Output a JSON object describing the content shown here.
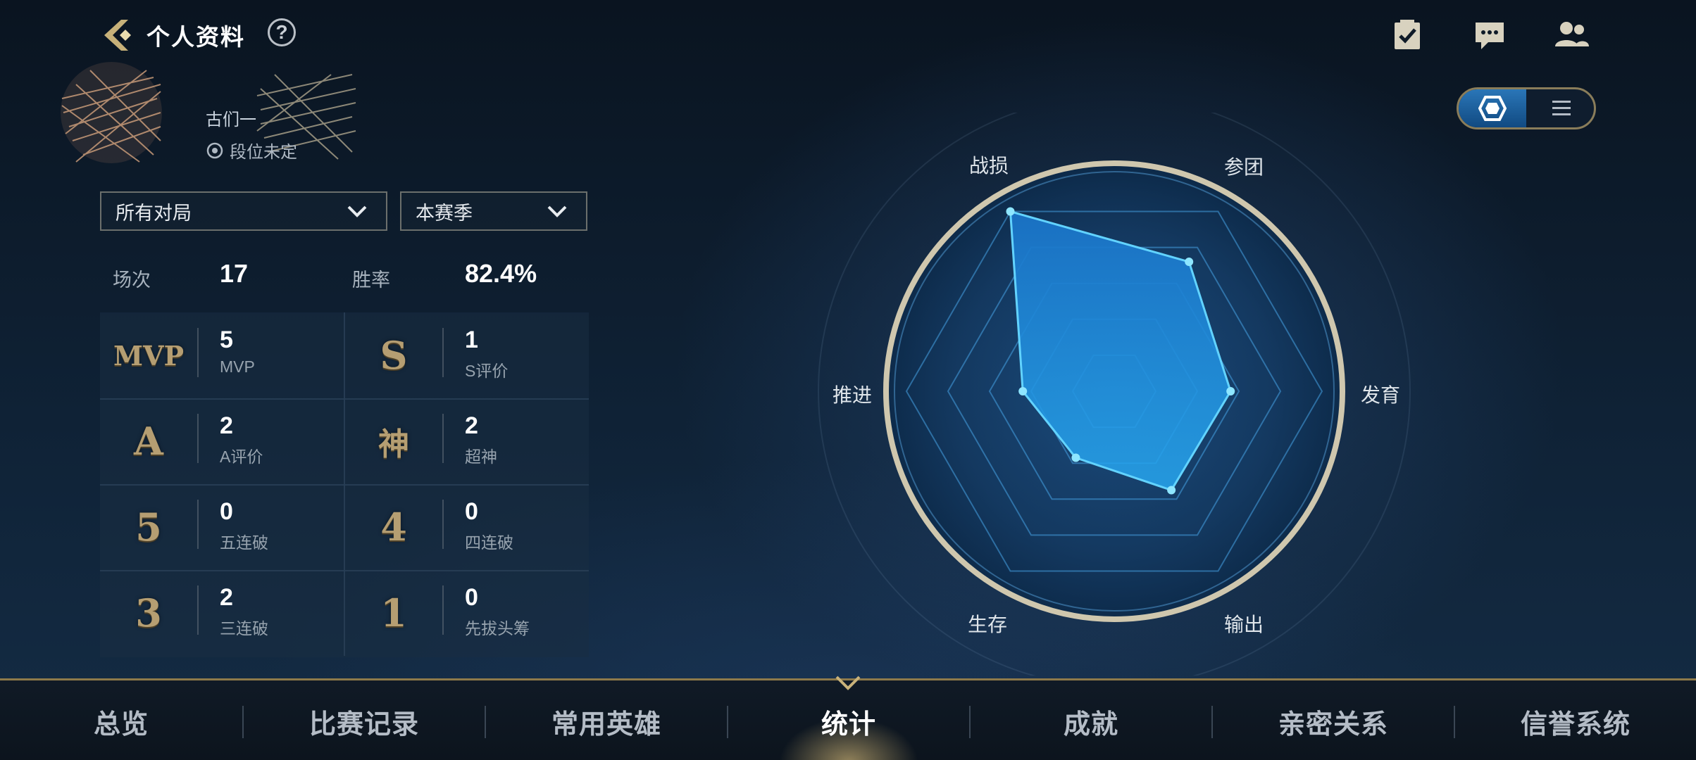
{
  "header": {
    "title": "个人资料",
    "help_label": "?"
  },
  "profile": {
    "name": "古们一",
    "rank_status": "段位未定"
  },
  "filters": {
    "mode": "所有对局",
    "season": "本赛季"
  },
  "summary": {
    "matches_label": "场次",
    "matches_value": "17",
    "winrate_label": "胜率",
    "winrate_value": "82.4%"
  },
  "stats": [
    {
      "badge": "MVP",
      "value": "5",
      "label": "MVP"
    },
    {
      "badge": "S",
      "value": "1",
      "label": "S评价"
    },
    {
      "badge": "A",
      "value": "2",
      "label": "A评价"
    },
    {
      "badge": "神",
      "value": "2",
      "label": "超神"
    },
    {
      "badge": "5",
      "value": "0",
      "label": "五连破"
    },
    {
      "badge": "4",
      "value": "0",
      "label": "四连破"
    },
    {
      "badge": "3",
      "value": "2",
      "label": "三连破"
    },
    {
      "badge": "1",
      "value": "0",
      "label": "先拔头筹"
    }
  ],
  "radar": {
    "axes": [
      "战损",
      "参团",
      "发育",
      "输出",
      "生存",
      "推进"
    ],
    "values": [
      1.0,
      0.72,
      0.56,
      0.55,
      0.37,
      0.44
    ],
    "colors": {
      "fill": "#1f86d6",
      "line": "#5fd0ff",
      "ring": "#c9c0a6"
    }
  },
  "view_toggle": {
    "active": "radar"
  },
  "nav": {
    "items": [
      "总览",
      "比赛记录",
      "常用英雄",
      "统计",
      "成就",
      "亲密关系",
      "信誉系统"
    ],
    "active_index": 3
  }
}
